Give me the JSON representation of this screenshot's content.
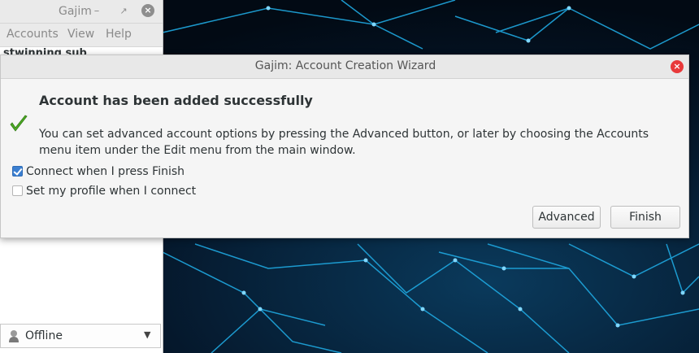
{
  "main_window": {
    "title": "Gajim",
    "menu": [
      "Accounts",
      "View",
      "Help"
    ],
    "account_partial": "stwinning sub",
    "status": "Offline"
  },
  "wizard": {
    "title": "Gajim: Account Creation Wizard",
    "heading": "Account has been added successfully",
    "message": "You can set advanced account options by pressing the Advanced button, or later by choosing the Accounts menu item under the Edit menu from the main window.",
    "options": [
      {
        "label": "Connect when I press Finish",
        "checked": true
      },
      {
        "label": "Set my profile when I connect",
        "checked": false
      }
    ],
    "buttons": {
      "advanced": "Advanced",
      "finish": "Finish"
    }
  },
  "colors": {
    "close_button": "#e8393a",
    "checkbox_checked": "#3b7fd1",
    "success_check": "#4eab25",
    "desktop_lines": "#1fa8e0"
  }
}
